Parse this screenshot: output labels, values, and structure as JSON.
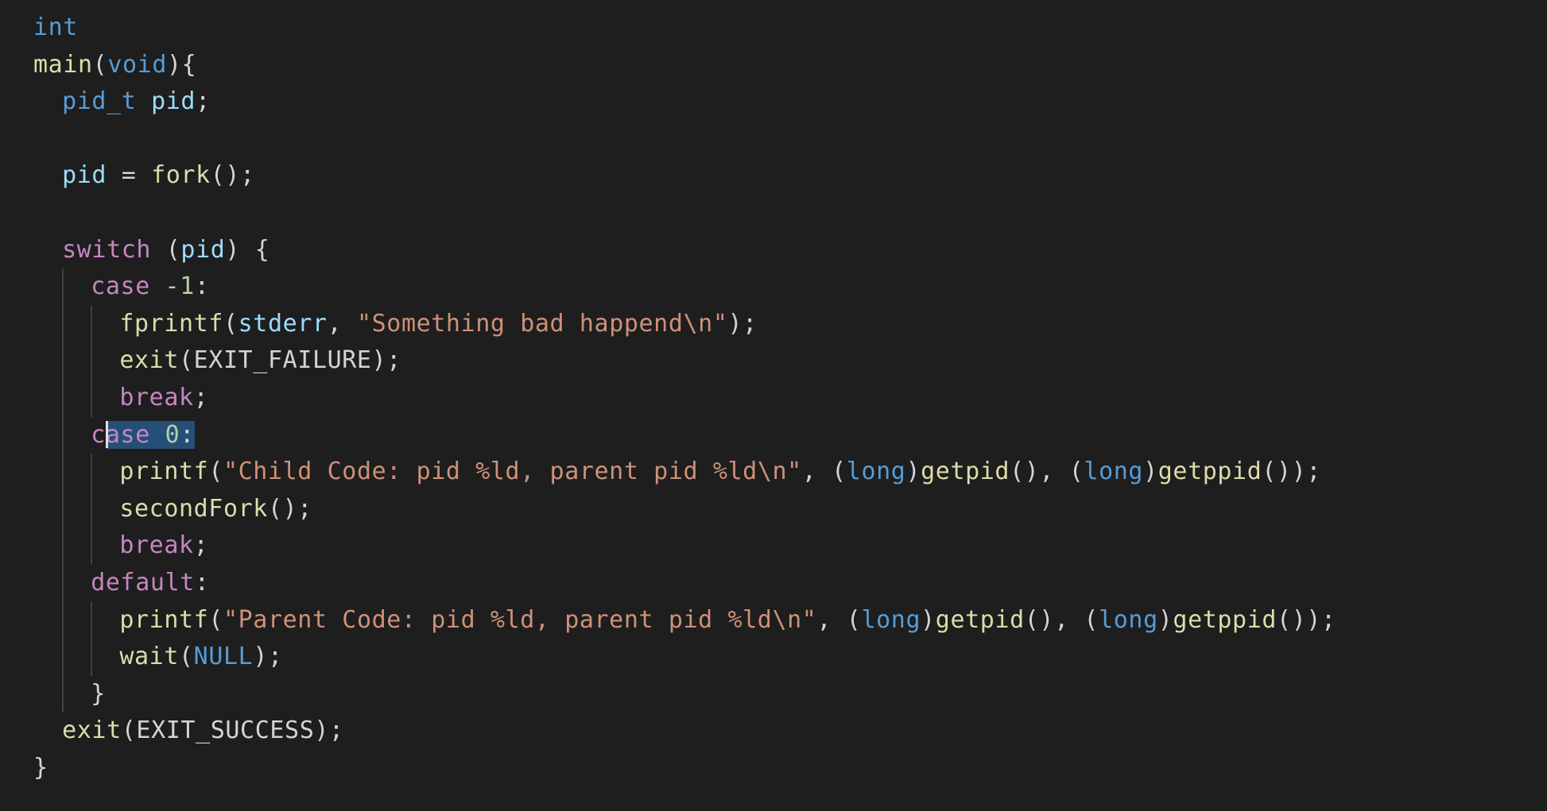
{
  "editor": {
    "language": "c",
    "colors": {
      "background": "#1e1e1e",
      "keyword": "#569cd6",
      "function": "#dcdcaa",
      "variable": "#9cdcfe",
      "control": "#c586c0",
      "string": "#ce9178",
      "number": "#b5cea8",
      "selection": "#264f78"
    },
    "lines": [
      {
        "indent": 0,
        "tokens": [
          [
            "int",
            "kw"
          ]
        ]
      },
      {
        "indent": 0,
        "tokens": [
          [
            "main",
            "fn"
          ],
          [
            "(",
            "pun"
          ],
          [
            "void",
            "kw"
          ],
          [
            "){",
            "pun"
          ]
        ]
      },
      {
        "indent": 1,
        "tokens": [
          [
            "pid_t",
            "kw"
          ],
          [
            " ",
            "pun"
          ],
          [
            "pid",
            "var"
          ],
          [
            ";",
            "pun"
          ]
        ]
      },
      {
        "indent": 1,
        "tokens": []
      },
      {
        "indent": 1,
        "tokens": [
          [
            "pid",
            "var"
          ],
          [
            " = ",
            "pun"
          ],
          [
            "fork",
            "fn"
          ],
          [
            "();",
            "pun"
          ]
        ]
      },
      {
        "indent": 1,
        "tokens": []
      },
      {
        "indent": 1,
        "tokens": [
          [
            "switch",
            "ctl"
          ],
          [
            " (",
            "pun"
          ],
          [
            "pid",
            "var"
          ],
          [
            ") {",
            "pun"
          ]
        ]
      },
      {
        "indent": 2,
        "tokens": [
          [
            "case",
            "ctl"
          ],
          [
            " ",
            "pun"
          ],
          [
            "-1",
            "num"
          ],
          [
            ":",
            "pun"
          ]
        ]
      },
      {
        "indent": 3,
        "tokens": [
          [
            "fprintf",
            "fn"
          ],
          [
            "(",
            "pun"
          ],
          [
            "stderr",
            "var"
          ],
          [
            ", ",
            "pun"
          ],
          [
            "\"Something bad happend\\n\"",
            "str"
          ],
          [
            ");",
            "pun"
          ]
        ]
      },
      {
        "indent": 3,
        "tokens": [
          [
            "exit",
            "fn"
          ],
          [
            "(EXIT_FAILURE);",
            "pun"
          ]
        ]
      },
      {
        "indent": 3,
        "tokens": [
          [
            "break",
            "ctl"
          ],
          [
            ";",
            "pun"
          ]
        ]
      },
      {
        "indent": 2,
        "tokens": [
          [
            "c",
            "ctl"
          ],
          [
            "ase",
            "ctl sel"
          ],
          [
            " ",
            "pun sel"
          ],
          [
            "0",
            "num sel"
          ],
          [
            ":",
            "pun sel"
          ]
        ]
      },
      {
        "indent": 3,
        "tokens": [
          [
            "printf",
            "fn"
          ],
          [
            "(",
            "pun"
          ],
          [
            "\"Child Code: pid %ld, parent pid %ld\\n\"",
            "str"
          ],
          [
            ", (",
            "pun"
          ],
          [
            "long",
            "kw"
          ],
          [
            ")",
            "pun"
          ],
          [
            "getpid",
            "fn"
          ],
          [
            "(), (",
            "pun"
          ],
          [
            "long",
            "kw"
          ],
          [
            ")",
            "pun"
          ],
          [
            "getppid",
            "fn"
          ],
          [
            "());",
            "pun"
          ]
        ]
      },
      {
        "indent": 3,
        "tokens": [
          [
            "secondFork",
            "fn"
          ],
          [
            "();",
            "pun"
          ]
        ]
      },
      {
        "indent": 3,
        "tokens": [
          [
            "break",
            "ctl"
          ],
          [
            ";",
            "pun"
          ]
        ]
      },
      {
        "indent": 2,
        "tokens": [
          [
            "default",
            "ctl"
          ],
          [
            ":",
            "pun"
          ]
        ]
      },
      {
        "indent": 3,
        "tokens": [
          [
            "printf",
            "fn"
          ],
          [
            "(",
            "pun"
          ],
          [
            "\"Parent Code: pid %ld, parent pid %ld\\n\"",
            "str"
          ],
          [
            ", (",
            "pun"
          ],
          [
            "long",
            "kw"
          ],
          [
            ")",
            "pun"
          ],
          [
            "getpid",
            "fn"
          ],
          [
            "(), (",
            "pun"
          ],
          [
            "long",
            "kw"
          ],
          [
            ")",
            "pun"
          ],
          [
            "getppid",
            "fn"
          ],
          [
            "());",
            "pun"
          ]
        ]
      },
      {
        "indent": 3,
        "tokens": [
          [
            "wait",
            "fn"
          ],
          [
            "(",
            "pun"
          ],
          [
            "NULL",
            "kw"
          ],
          [
            ");",
            "pun"
          ]
        ]
      },
      {
        "indent": 2,
        "tokens": [
          [
            "}",
            "pun"
          ]
        ]
      },
      {
        "indent": 1,
        "tokens": [
          [
            "exit",
            "fn"
          ],
          [
            "(EXIT_SUCCESS);",
            "pun"
          ]
        ]
      },
      {
        "indent": 0,
        "tokens": [
          [
            "}",
            "pun"
          ]
        ]
      }
    ]
  }
}
